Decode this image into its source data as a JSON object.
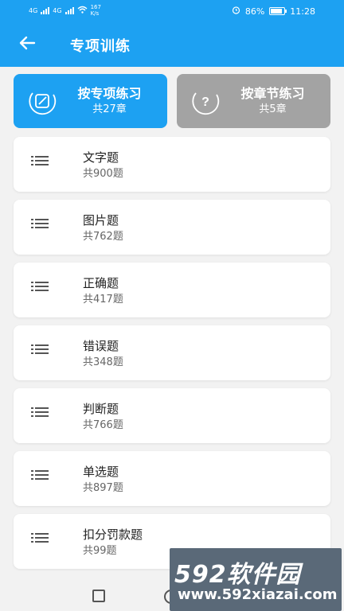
{
  "status_bar": {
    "signal_1": "4G",
    "signal_2": "4G",
    "speed": "167\nK/s",
    "battery": "86%",
    "time": "11:28",
    "battery_fill_percent": 86
  },
  "header": {
    "title": "专项训练",
    "back_icon": "arrow-left-icon"
  },
  "modes": [
    {
      "label": "按专项练习",
      "sub": "共27章",
      "icon": "edit-note-icon",
      "active": true
    },
    {
      "label": "按章节练习",
      "sub": "共5章",
      "icon": "question-circle-icon",
      "active": false
    }
  ],
  "items": [
    {
      "title": "文字题",
      "count": "共900题"
    },
    {
      "title": "图片题",
      "count": "共762题"
    },
    {
      "title": "正确题",
      "count": "共417题"
    },
    {
      "title": "错误题",
      "count": "共348题"
    },
    {
      "title": "判断题",
      "count": "共766题"
    },
    {
      "title": "单选题",
      "count": "共897题"
    },
    {
      "title": "扣分罚款题",
      "count": "共99题"
    }
  ],
  "watermark": {
    "brand": "592软件园",
    "url": "www.592xiazai.com"
  },
  "colors": {
    "primary": "#1da1f2",
    "inactive": "#a3a3a3"
  }
}
